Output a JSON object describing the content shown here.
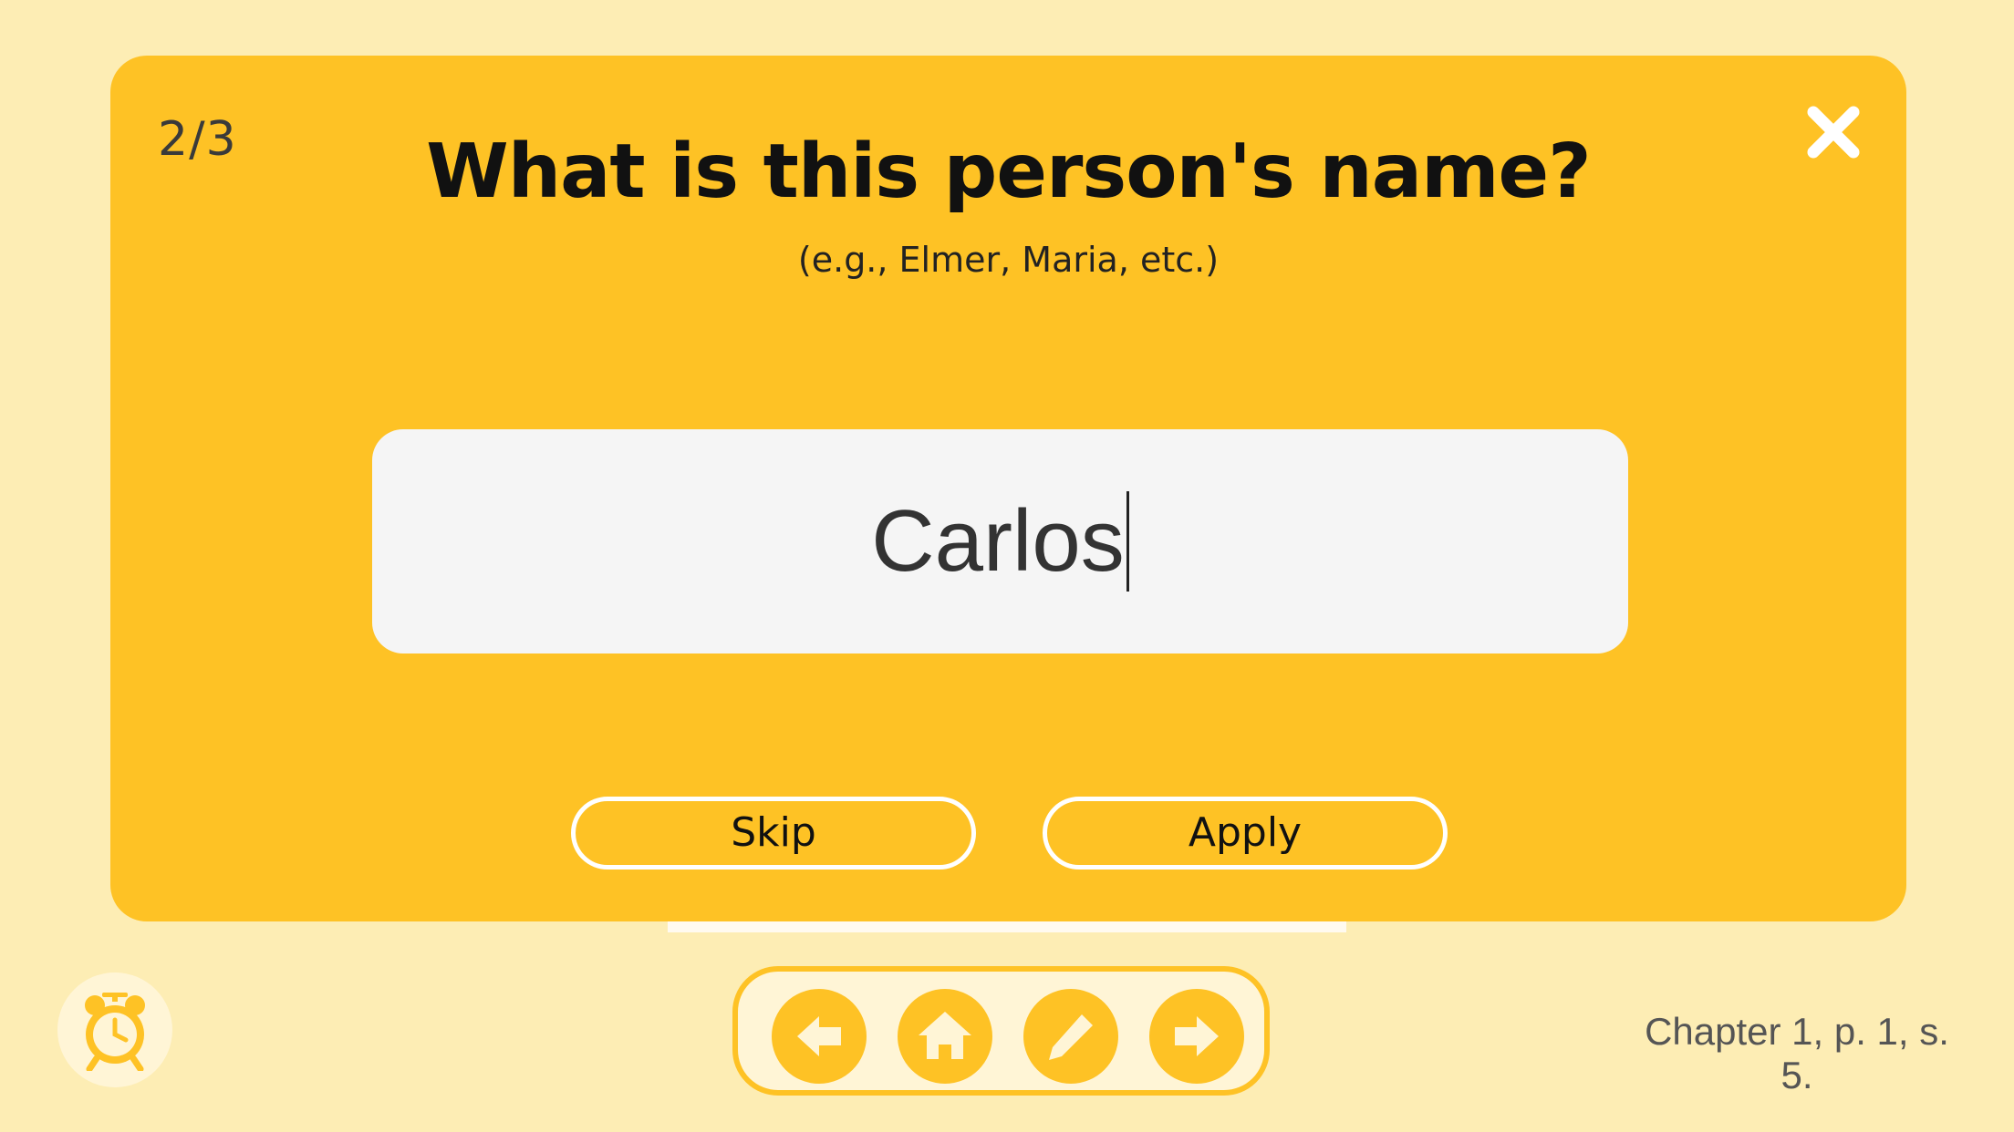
{
  "modal": {
    "counter": "2/3",
    "question": "What is this person's name?",
    "hint": "(e.g., Elmer, Maria, etc.)",
    "answer_value": "Carlos",
    "skip_label": "Skip",
    "apply_label": "Apply",
    "close_icon": "close-icon"
  },
  "toolbar": {
    "alarm_icon": "alarm-clock-icon",
    "nav_buttons": [
      {
        "icon": "arrow-left-icon"
      },
      {
        "icon": "home-icon"
      },
      {
        "icon": "pencil-icon"
      },
      {
        "icon": "arrow-right-icon"
      }
    ]
  },
  "location": {
    "text": "Chapter 1, p. 1, s. 5."
  },
  "colors": {
    "background": "#fdedb4",
    "accent": "#fec225",
    "input_bg": "#f5f5f5",
    "button_bg": "#fff5d6"
  }
}
